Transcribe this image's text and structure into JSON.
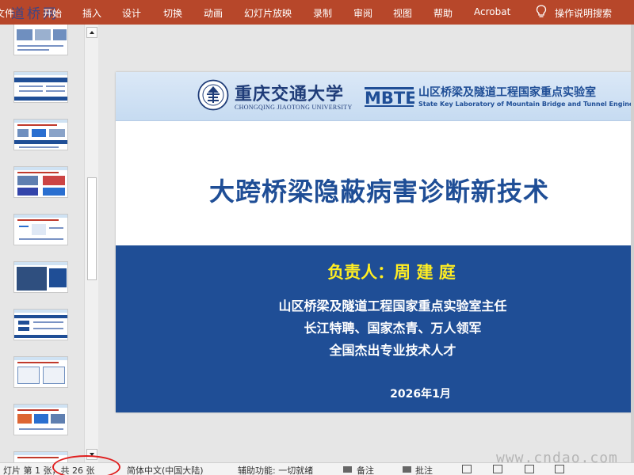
{
  "ribbon": {
    "tabs": [
      "文件",
      "开始",
      "插入",
      "设计",
      "切换",
      "动画",
      "幻灯片放映",
      "录制",
      "审阅",
      "视图",
      "帮助",
      "Acrobat",
      "操作说明搜索"
    ],
    "watermark": "道桥网",
    "color": "#b7472a",
    "search_icon": "lightbulb-icon"
  },
  "slide": {
    "university_cn": "重庆交通大学",
    "university_en": "CHONGQING JIAOTONG UNIVERSITY",
    "lab_logo": "MBTE",
    "lab_cn": "山区桥梁及隧道工程国家重点实验室",
    "lab_en": "State Key Laboratory of Mountain Bridge and Tunnel Engineering",
    "title": "大跨桥梁隐蔽病害诊断新技术",
    "leader": "负责人：周 建 庭",
    "lines": [
      "山区桥梁及隧道工程国家重点实验室主任",
      "长江特聘、国家杰青、万人领军",
      "全国杰出专业技术人才"
    ],
    "date": "2026年1月",
    "colors": {
      "title": "#1f4e96",
      "band": "#1f4e96",
      "leader": "#ffee22"
    }
  },
  "status": {
    "slide_info": "灯片 第 1 张，共 26 张",
    "language": "简体中文(中国大陆)",
    "accessibility": "辅助功能: 一切就绪",
    "notes": "备注",
    "comments": "批注"
  },
  "watermark_site": "www.cndao.com"
}
